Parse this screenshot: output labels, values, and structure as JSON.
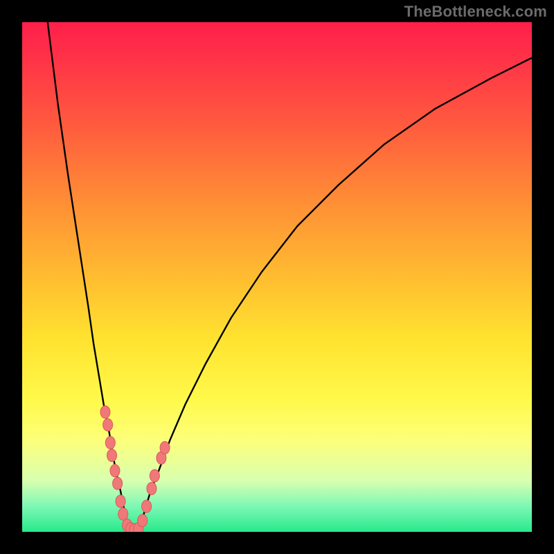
{
  "watermark": "TheBottleneck.com",
  "chart_data": {
    "type": "line",
    "title": "",
    "xlabel": "",
    "ylabel": "",
    "xlim": [
      0,
      100
    ],
    "ylim": [
      0,
      100
    ],
    "grid": false,
    "legend": false,
    "series": [
      {
        "name": "left-curve",
        "x": [
          5,
          7,
          9,
          11,
          13,
          14,
          15,
          16,
          17,
          18,
          18.6,
          19.3,
          20.1,
          21.0
        ],
        "y": [
          100,
          84,
          70,
          57,
          44,
          37,
          31,
          25,
          20,
          14,
          11,
          8,
          4,
          0
        ]
      },
      {
        "name": "right-curve",
        "x": [
          23.0,
          24.0,
          25.2,
          26.8,
          29,
          32,
          36,
          41,
          47,
          54,
          62,
          71,
          81,
          92,
          100
        ],
        "y": [
          0,
          4,
          8,
          12,
          18,
          25,
          33,
          42,
          51,
          60,
          68,
          76,
          83,
          89,
          93
        ]
      }
    ],
    "valley_floor": {
      "name": "valley-join",
      "x": [
        21.0,
        21.6,
        22.2,
        22.8,
        23.0
      ],
      "y": [
        0,
        0,
        0,
        0,
        0
      ]
    },
    "markers": [
      {
        "x": 16.3,
        "y": 23.5
      },
      {
        "x": 16.8,
        "y": 21.0
      },
      {
        "x": 17.3,
        "y": 17.5
      },
      {
        "x": 17.6,
        "y": 15.0
      },
      {
        "x": 18.2,
        "y": 12.0
      },
      {
        "x": 18.7,
        "y": 9.5
      },
      {
        "x": 19.3,
        "y": 6.0
      },
      {
        "x": 19.8,
        "y": 3.5
      },
      {
        "x": 20.6,
        "y": 1.3
      },
      {
        "x": 21.3,
        "y": 0.6
      },
      {
        "x": 22.0,
        "y": 0.4
      },
      {
        "x": 22.8,
        "y": 0.6
      },
      {
        "x": 23.6,
        "y": 2.2
      },
      {
        "x": 24.4,
        "y": 5.0
      },
      {
        "x": 25.4,
        "y": 8.5
      },
      {
        "x": 26.0,
        "y": 11.0
      },
      {
        "x": 27.3,
        "y": 14.5
      },
      {
        "x": 28.0,
        "y": 16.5
      }
    ],
    "marker_style": {
      "fill": "#f07878",
      "stroke": "#d85a5a",
      "rx": 7,
      "ry": 9
    },
    "gradient_colors": {
      "top": "#ff1f4b",
      "mid": "#ffe22f",
      "bottom": "#28e98a"
    }
  }
}
